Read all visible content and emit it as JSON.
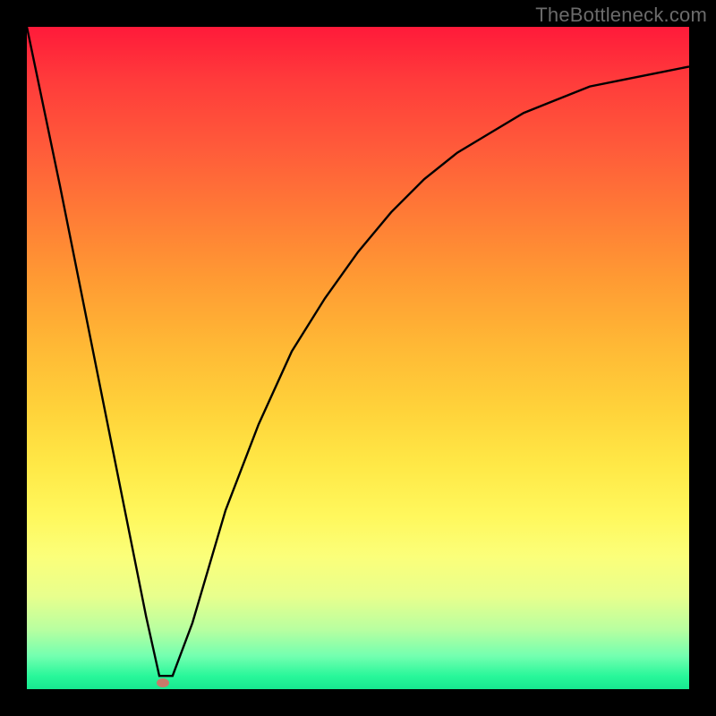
{
  "watermark": "TheBottleneck.com",
  "chart_data": {
    "type": "line",
    "title": "",
    "xlabel": "",
    "ylabel": "",
    "xlim": [
      0,
      100
    ],
    "ylim": [
      0,
      100
    ],
    "grid": false,
    "series": [
      {
        "name": "bottleneck-curve",
        "x": [
          0,
          5,
          10,
          15,
          18,
          20,
          22,
          25,
          30,
          35,
          40,
          45,
          50,
          55,
          60,
          65,
          70,
          75,
          80,
          85,
          90,
          95,
          100
        ],
        "y": [
          100,
          76,
          51,
          26,
          11,
          2,
          2,
          10,
          27,
          40,
          51,
          59,
          66,
          72,
          77,
          81,
          84,
          87,
          89,
          91,
          92,
          93,
          94
        ]
      }
    ],
    "marker": {
      "x": 20.5,
      "y": 1
    },
    "gradient_stops": [
      {
        "pct": 0,
        "color": "#ff1a3a"
      },
      {
        "pct": 50,
        "color": "#ffc23a"
      },
      {
        "pct": 80,
        "color": "#fdff70"
      },
      {
        "pct": 100,
        "color": "#17e890"
      }
    ]
  }
}
